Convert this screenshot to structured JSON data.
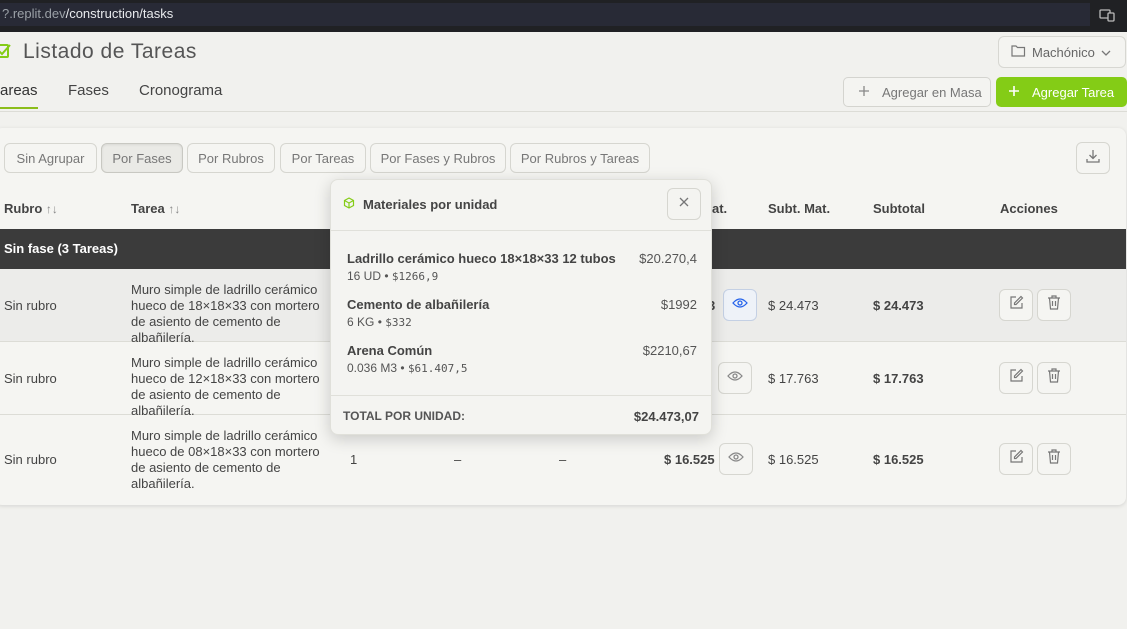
{
  "browser": {
    "url_prefix": "?.replit.dev",
    "url_path": "/construction/tasks"
  },
  "header": {
    "title": "Listado de Tareas",
    "company_selector": "Machónico"
  },
  "tabs": [
    {
      "label": "areas"
    },
    {
      "label": "Fases"
    },
    {
      "label": "Cronograma"
    }
  ],
  "actions": {
    "mass_add": "Agregar en Masa",
    "add_task": "Agregar Tarea"
  },
  "grouping": [
    "Sin Agrupar",
    "Por Fases",
    "Por Rubros",
    "Por Tareas",
    "Por Fases y Rubros",
    "Por Rubros y Tareas"
  ],
  "table": {
    "headers": {
      "rubro": "Rubro",
      "tarea": "Tarea",
      "mat_partial": "at.",
      "subt_mat": "Subt. Mat.",
      "subtotal": "Subtotal",
      "acciones": "Acciones",
      "sort_glyph": "↑↓"
    },
    "phase_label": "Sin fase (3 Tareas)",
    "rows": [
      {
        "rubro": "Sin rubro",
        "tarea": "Muro simple de ladrillo cerámico hueco de 18×18×33 con mortero de asiento de cemento de albañilería.",
        "qty": "",
        "c1": "",
        "c2": "",
        "mat": "3",
        "subt_mat": "$ 24.473",
        "subtotal": "$ 24.473"
      },
      {
        "rubro": "Sin rubro",
        "tarea": "Muro simple de ladrillo cerámico hueco de 12×18×33 con mortero de asiento de cemento de albañilería.",
        "qty": "",
        "c1": "",
        "c2": "",
        "mat": "",
        "subt_mat": "$ 17.763",
        "subtotal": "$ 17.763"
      },
      {
        "rubro": "Sin rubro",
        "tarea": "Muro simple de ladrillo cerámico hueco de 08×18×33 con mortero de asiento de cemento de albañilería.",
        "qty": "1",
        "c1": "–",
        "c2": "–",
        "mat": "$ 16.525",
        "subt_mat": "$ 16.525",
        "subtotal": "$ 16.525"
      }
    ]
  },
  "popover": {
    "title": "Materiales por unidad",
    "materials": [
      {
        "name": "Ladrillo cerámico hueco 18×18×33 12 tubos",
        "price": "$20.270,4",
        "qty": "16 UD",
        "unit_price": "$1266,9"
      },
      {
        "name": "Cemento de albañilería",
        "price": "$1992",
        "qty": "6 KG",
        "unit_price": "$332"
      },
      {
        "name": "Arena Común",
        "price": "$2210,67",
        "qty": "0.036 M3",
        "unit_price": "$61.407,5"
      }
    ],
    "bullet": "•",
    "total_label": "TOTAL POR UNIDAD:",
    "total_value": "$24.473,07"
  },
  "colors": {
    "accent": "#84cc16",
    "phase_bar": "#3b3b3b",
    "background": "#f1f1ee"
  }
}
